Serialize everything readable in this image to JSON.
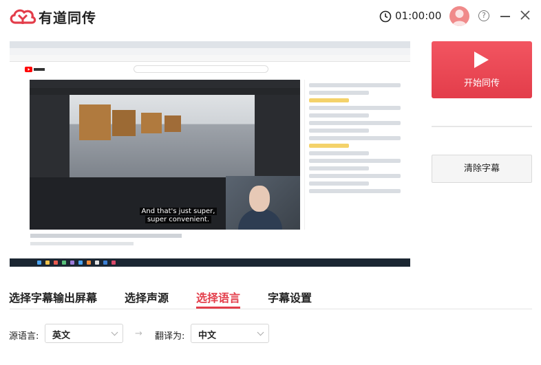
{
  "header": {
    "app_title": "有道同传",
    "timer": "01:00:00",
    "help_symbol": "?"
  },
  "preview": {
    "subtitle_line1": "And that's just super,",
    "subtitle_line2": "super convenient."
  },
  "controls": {
    "start_label": "开始同传",
    "clear_label": "清除字幕"
  },
  "tabs": [
    {
      "label": "选择字幕输出屏幕",
      "active": false
    },
    {
      "label": "选择声源",
      "active": false
    },
    {
      "label": "选择语言",
      "active": true
    },
    {
      "label": "字幕设置",
      "active": false
    }
  ],
  "language": {
    "source_label": "源语言:",
    "source_value": "英文",
    "arrow": "→",
    "target_label": "翻译为:",
    "target_value": "中文"
  },
  "colors": {
    "accent": "#e33d4a",
    "accent_light": "#f25561"
  }
}
